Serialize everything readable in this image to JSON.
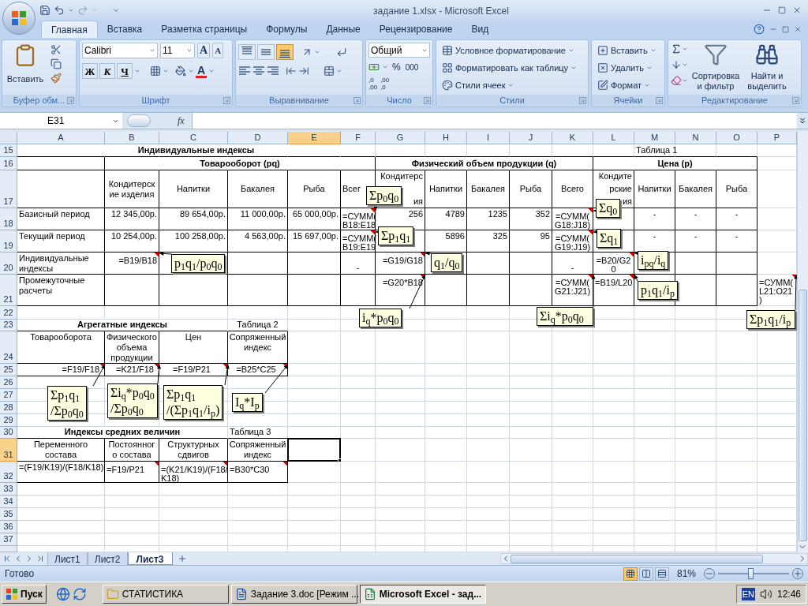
{
  "title_bar": {
    "title": "задание 1.xlsx - Microsoft Excel"
  },
  "tabs": [
    {
      "label": "Главная",
      "selected": true
    },
    {
      "label": "Вставка",
      "selected": false
    },
    {
      "label": "Разметка страницы",
      "selected": false
    },
    {
      "label": "Формулы",
      "selected": false
    },
    {
      "label": "Данные",
      "selected": false
    },
    {
      "label": "Рецензирование",
      "selected": false
    },
    {
      "label": "Вид",
      "selected": false
    }
  ],
  "ribbon": {
    "clipboard": {
      "label": "Буфер обм...",
      "paste": "Вставить"
    },
    "font": {
      "label": "Шрифт",
      "name": "Calibri",
      "size": "11",
      "grow": "A",
      "shrink": "A",
      "bold": "Ж",
      "italic": "К",
      "underline": "Ч",
      "foreground_letter": "A"
    },
    "alignment": {
      "label": "Выравнивание",
      "vertical": [
        {
          "selected": false
        },
        {
          "selected": false
        },
        {
          "selected": true
        }
      ]
    },
    "number": {
      "label": "Число",
      "format": "Общий",
      "percent": "%",
      "thousands": "000",
      "increase_decimal": [
        ",0",
        ",00"
      ],
      "decrease_decimal": [
        ",00",
        ",0"
      ]
    },
    "styles": {
      "label": "Стили",
      "items": [
        "Условное форматирование",
        "Форматировать как таблицу",
        "Стили ячеек"
      ]
    },
    "cells": {
      "label": "Ячейки",
      "items": [
        "Вставить",
        "Удалить",
        "Формат"
      ]
    },
    "editing": {
      "label": "Редактирование",
      "sort": [
        "Сортировка",
        "и фильтр"
      ],
      "find": [
        "Найти и",
        "выделить"
      ]
    }
  },
  "formula_bar": {
    "name_box": "E31",
    "function_label": "fx"
  },
  "sheet": {
    "columns": [
      {
        "label": "A",
        "selected": false
      },
      {
        "label": "B",
        "selected": false
      },
      {
        "label": "C",
        "selected": false
      },
      {
        "label": "D",
        "selected": false
      },
      {
        "label": "E",
        "selected": true
      },
      {
        "label": "F",
        "selected": false
      },
      {
        "label": "G",
        "selected": false
      },
      {
        "label": "H",
        "selected": false
      },
      {
        "label": "I",
        "selected": false
      },
      {
        "label": "J",
        "selected": false
      },
      {
        "label": "K",
        "selected": false
      },
      {
        "label": "L",
        "selected": false
      },
      {
        "label": "M",
        "selected": false
      },
      {
        "label": "N",
        "selected": false
      },
      {
        "label": "O",
        "selected": false
      },
      {
        "label": "P",
        "selected": false
      }
    ],
    "rows": [
      {
        "number": "15",
        "selected": false,
        "merged": [
          {
            "text": "Индивидуальные индексы"
          }
        ],
        "cells": [
          {
            "text": "",
            "comment": false
          },
          {
            "text": "",
            "comment": false
          },
          {
            "text": "",
            "comment": false
          },
          {
            "text": "",
            "comment": false
          },
          {
            "text": "",
            "comment": false
          },
          {
            "text": "",
            "comment": false
          },
          {
            "text": "",
            "comment": false
          },
          {
            "text": "",
            "comment": false
          },
          {
            "text": "",
            "comment": false
          },
          {
            "text": "",
            "comment": false
          },
          {
            "text": "",
            "comment": false
          },
          {
            "text": "",
            "comment": false
          },
          {
            "text": "Таблица 1",
            "comment": false
          }
        ]
      },
      {
        "number": "16",
        "selected": false,
        "merged": [
          {
            "text": "Товарооборот (pq)"
          },
          {
            "text": "Физический объем продукции (q)"
          },
          {
            "text": "Цена (р)"
          }
        ],
        "cells": [
          {
            "text": "",
            "comment": false
          }
        ]
      },
      {
        "number": "17",
        "selected": false,
        "cells": [
          {
            "text": "",
            "comment": false
          },
          {
            "lines": [
              "Кондитерск",
              "ие изделия"
            ],
            "comment": false
          },
          {
            "text": "Напитки",
            "comment": false
          },
          {
            "text": "Бакалея",
            "comment": false
          },
          {
            "text": "Рыба",
            "comment": false
          },
          {
            "text": "Всег",
            "comment": false
          },
          {
            "lines": [
              "Кондитерс",
              "ия"
            ],
            "comment": false
          },
          {
            "text": "Напитки",
            "comment": false
          },
          {
            "text": "Бакалея",
            "comment": false
          },
          {
            "text": "Рыба",
            "comment": false
          },
          {
            "text": "Всего",
            "comment": false
          },
          {
            "lines": [
              "Кондите",
              "рские",
              "ия"
            ],
            "comment": false
          },
          {
            "text": "Напитки",
            "comment": false
          },
          {
            "text": "Бакалея",
            "comment": false
          },
          {
            "text": "Рыба",
            "comment": false
          }
        ]
      },
      {
        "number": "18",
        "selected": false,
        "cells": [
          {
            "text": "Базисный период",
            "comment": false
          },
          {
            "text": "12 345,00р.",
            "comment": false
          },
          {
            "text": "89 654,00р.",
            "comment": false
          },
          {
            "text": "11 000,00р.",
            "comment": false
          },
          {
            "text": "65 000,00р.",
            "comment": false
          },
          {
            "lines": [
              "=СУММ(",
              "B18:E18"
            ],
            "comment": true
          },
          {
            "text": "256",
            "comment": false
          },
          {
            "text": "4789",
            "comment": false
          },
          {
            "text": "1235",
            "comment": false
          },
          {
            "text": "352",
            "comment": false
          },
          {
            "lines": [
              "=СУММ(",
              "G18:J18)"
            ],
            "comment": true
          },
          {
            "text": "",
            "comment": false
          },
          {
            "text": "-",
            "comment": false
          },
          {
            "text": "-",
            "comment": false
          },
          {
            "text": "-",
            "comment": false
          }
        ]
      },
      {
        "number": "19",
        "selected": false,
        "cells": [
          {
            "text": "Текущий период",
            "comment": false
          },
          {
            "text": "10 254,00р.",
            "comment": false
          },
          {
            "text": "100 258,00р.",
            "comment": false
          },
          {
            "text": "4 563,00р.",
            "comment": false
          },
          {
            "text": "15 697,00р.",
            "comment": false
          },
          {
            "lines": [
              "=СУММ(",
              "B19:E19"
            ],
            "comment": true
          },
          {
            "text": "",
            "comment": false
          },
          {
            "text": "5896",
            "comment": false
          },
          {
            "text": "325",
            "comment": false
          },
          {
            "text": "95",
            "comment": false
          },
          {
            "lines": [
              "=СУММ(",
              "G19:J19)"
            ],
            "comment": true
          },
          {
            "text": "",
            "comment": false
          },
          {
            "text": "-",
            "comment": false
          },
          {
            "text": "-",
            "comment": false
          },
          {
            "text": "-",
            "comment": false
          }
        ]
      },
      {
        "number": "20",
        "selected": false,
        "cells": [
          {
            "lines": [
              "Индивидуальные",
              "индексы"
            ],
            "comment": false
          },
          {
            "text": "=B19/B18",
            "comment": true
          },
          {
            "text": "",
            "comment": false
          },
          {
            "text": "",
            "comment": false
          },
          {
            "text": "",
            "comment": false
          },
          {
            "text": "-",
            "comment": false
          },
          {
            "text": "=G19/G18",
            "comment": true
          },
          {
            "text": "",
            "comment": false
          },
          {
            "text": "",
            "comment": false
          },
          {
            "text": "",
            "comment": false
          },
          {
            "text": "-",
            "comment": false
          },
          {
            "lines": [
              "=B20/G2",
              "0"
            ],
            "comment": true
          }
        ]
      },
      {
        "number": "21",
        "selected": false,
        "cells": [
          {
            "lines": [
              "Промежуточные",
              "расчеты"
            ],
            "comment": false
          },
          {
            "text": "",
            "comment": false
          },
          {
            "text": "",
            "comment": false
          },
          {
            "text": "",
            "comment": false
          },
          {
            "text": "",
            "comment": false
          },
          {
            "text": "",
            "comment": false
          },
          {
            "text": "=G20*B18",
            "comment": true
          },
          {
            "text": "",
            "comment": false
          },
          {
            "text": "",
            "comment": false
          },
          {
            "text": "",
            "comment": false
          },
          {
            "lines": [
              "=СУММ(",
              "G21:J21)"
            ],
            "comment": true
          },
          {
            "text": "=B19/L20",
            "comment": true
          },
          {
            "text": "",
            "comment": false
          },
          {
            "text": "",
            "comment": false
          },
          {
            "text": "",
            "comment": false
          },
          {
            "lines": [
              "=СУММ(",
              "L21:O21",
              ")"
            ],
            "comment": true
          }
        ]
      },
      {
        "number": "22",
        "selected": false,
        "cells": []
      },
      {
        "number": "23",
        "selected": false,
        "merged": [
          {
            "text": "Агрегатные индексы"
          }
        ],
        "cells": [
          {
            "text": "",
            "comment": false
          },
          {
            "text": "",
            "comment": false
          },
          {
            "text": "",
            "comment": false
          },
          {
            "text": "Таблица 2",
            "comment": false
          }
        ]
      },
      {
        "number": "24",
        "selected": false,
        "cells": [
          {
            "text": "Товарооборота",
            "comment": false
          },
          {
            "lines": [
              "Физического",
              "объема",
              "продукции"
            ],
            "comment": false
          },
          {
            "text": "Цен",
            "comment": false
          },
          {
            "lines": [
              "Сопряженный",
              "индекс"
            ],
            "comment": false
          }
        ]
      },
      {
        "number": "25",
        "selected": false,
        "cells": [
          {
            "text": "=F19/F18",
            "comment": true
          },
          {
            "text": "=K21/F18",
            "comment": true
          },
          {
            "text": "=F19/P21",
            "comment": true
          },
          {
            "text": "=B25*C25",
            "comment": true
          }
        ]
      },
      {
        "number": "26",
        "selected": false,
        "cells": []
      },
      {
        "number": "27",
        "selected": false,
        "cells": []
      },
      {
        "number": "28",
        "selected": false,
        "cells": []
      },
      {
        "number": "29",
        "selected": false,
        "cells": []
      },
      {
        "number": "30",
        "selected": false,
        "merged": [
          {
            "text": "Индексы средних величин"
          }
        ],
        "cells": [
          {
            "text": "",
            "comment": false
          },
          {
            "text": "",
            "comment": false
          },
          {
            "text": "",
            "comment": false
          },
          {
            "text": "Таблица 3",
            "comment": false
          }
        ]
      },
      {
        "number": "31",
        "selected": true,
        "cells": [
          {
            "lines": [
              "Переменного",
              "состава"
            ],
            "comment": false
          },
          {
            "lines": [
              "Постоянног",
              "о состава"
            ],
            "comment": false
          },
          {
            "lines": [
              "Структурных",
              "сдвигов"
            ],
            "comment": false
          },
          {
            "lines": [
              "Сопряженный",
              "индекс"
            ],
            "comment": false
          }
        ]
      },
      {
        "number": "32",
        "selected": false,
        "cells": [
          {
            "text": "=(F19/K19)/(F18/K18)",
            "comment": false
          },
          {
            "text": "=F19/P21",
            "comment": true
          },
          {
            "lines": [
              "=(K21/K19)/(F18/",
              "K18)"
            ],
            "comment": true
          },
          {
            "text": "=B30*C30",
            "comment": true
          }
        ]
      },
      {
        "number": "33",
        "selected": false,
        "cells": []
      },
      {
        "number": "34",
        "selected": false,
        "cells": []
      },
      {
        "number": "35",
        "selected": false,
        "cells": []
      },
      {
        "number": "36",
        "selected": false,
        "cells": []
      },
      {
        "number": "37",
        "selected": false,
        "cells": []
      },
      {
        "selected": false,
        "cells": []
      }
    ],
    "comments": [
      {
        "lines": [
          "Σp$_{0}$q$_{0}$"
        ]
      },
      {
        "lines": [
          "Σp$_{1}$q$_{1}$"
        ]
      },
      {
        "lines": [
          "p$_{1}$q$_{1}$/p$_{0}$q$_{0}$"
        ]
      },
      {
        "lines": [
          "q$_{1}$/q$_{0}$"
        ]
      },
      {
        "lines": [
          "i$_{q}$*p$_{0}$q$_{0}$"
        ]
      },
      {
        "lines": [
          "Σi$_{q}$*p$_{0}$q$_{0}$"
        ]
      },
      {
        "lines": [
          "Σq$_{0}$"
        ]
      },
      {
        "lines": [
          "Σq$_{1}$"
        ]
      },
      {
        "lines": [
          "i$_{pq}$/i$_{q}$"
        ]
      },
      {
        "lines": [
          "p$_{1}$q$_{1}$/i$_{p}$"
        ]
      },
      {
        "lines": [
          "Σp$_{1}$q$_{1}$/i$_{p}$"
        ]
      },
      {
        "lines": [
          "Σp$_{1}$q$_{1}$",
          "/Σp$_{0}$q$_{0}$"
        ]
      },
      {
        "lines": [
          "Σi$_{q}$*p$_{0}$q$_{0}$",
          "/Σp$_{0}$q$_{0}$"
        ]
      },
      {
        "lines": [
          "Σp$_{1}$q$_{1}$",
          "/(Σp$_{1}$q$_{1}$/i$_{p}$)"
        ]
      },
      {
        "lines": [
          "I$_{q}$*I$_{p}$"
        ]
      }
    ]
  },
  "sheet_tabs": [
    {
      "label": "Лист1",
      "selected": false
    },
    {
      "label": "Лист2",
      "selected": false
    },
    {
      "label": "Лист3",
      "selected": true
    }
  ],
  "status_bar": {
    "status": "Готово",
    "views": [
      {
        "selected": true
      },
      {
        "selected": false
      },
      {
        "selected": false
      }
    ],
    "zoom": "81%",
    "zoom_slider": {
      "level": 0.45
    }
  },
  "taskbar": {
    "start": "Пуск",
    "tasks": [
      {
        "label": "СТАТИСТИКА",
        "kind": "folder",
        "selected": false
      },
      {
        "label": "Задание 3.doc [Режим ...",
        "kind": "document",
        "selected": false
      },
      {
        "label": "Microsoft Excel - зад...",
        "kind": "spreadsheet",
        "selected": true
      }
    ],
    "language": "EN",
    "time": "12:46"
  }
}
